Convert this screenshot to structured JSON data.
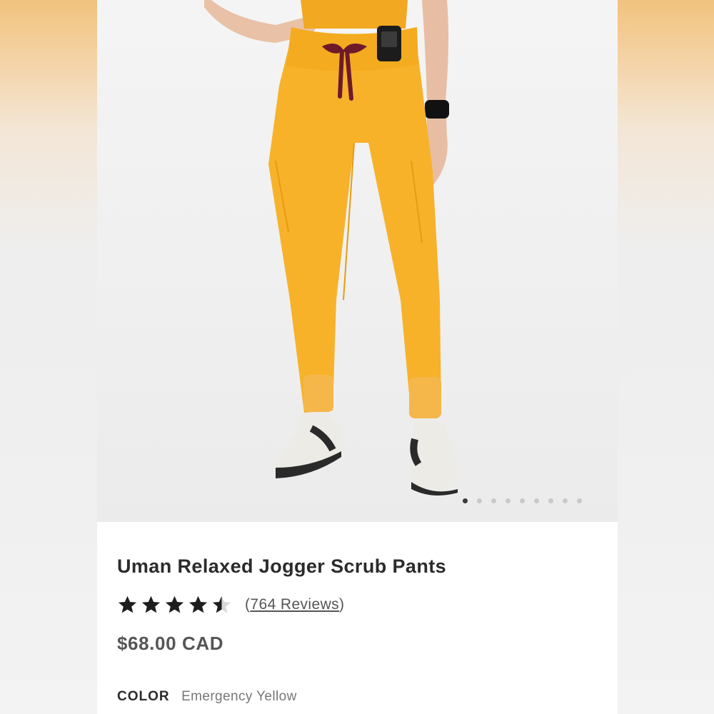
{
  "product": {
    "title": "Uman Relaxed Jogger Scrub Pants",
    "rating": 4.5,
    "rating_max": 5,
    "reviews_open": "(",
    "reviews_text": "764 Reviews",
    "reviews_close": ")",
    "price": "$68.00 CAD",
    "color_label": "COLOR",
    "color_value": "Emergency Yellow"
  },
  "gallery": {
    "image_icon": "product-photo",
    "slide_count": 9,
    "active_slide": 1
  },
  "colors": {
    "product_yellow": "#f7b22a",
    "drawstring": "#6e1a2b",
    "star": "#1e1e1e",
    "star_empty": "#d9d9d9"
  }
}
